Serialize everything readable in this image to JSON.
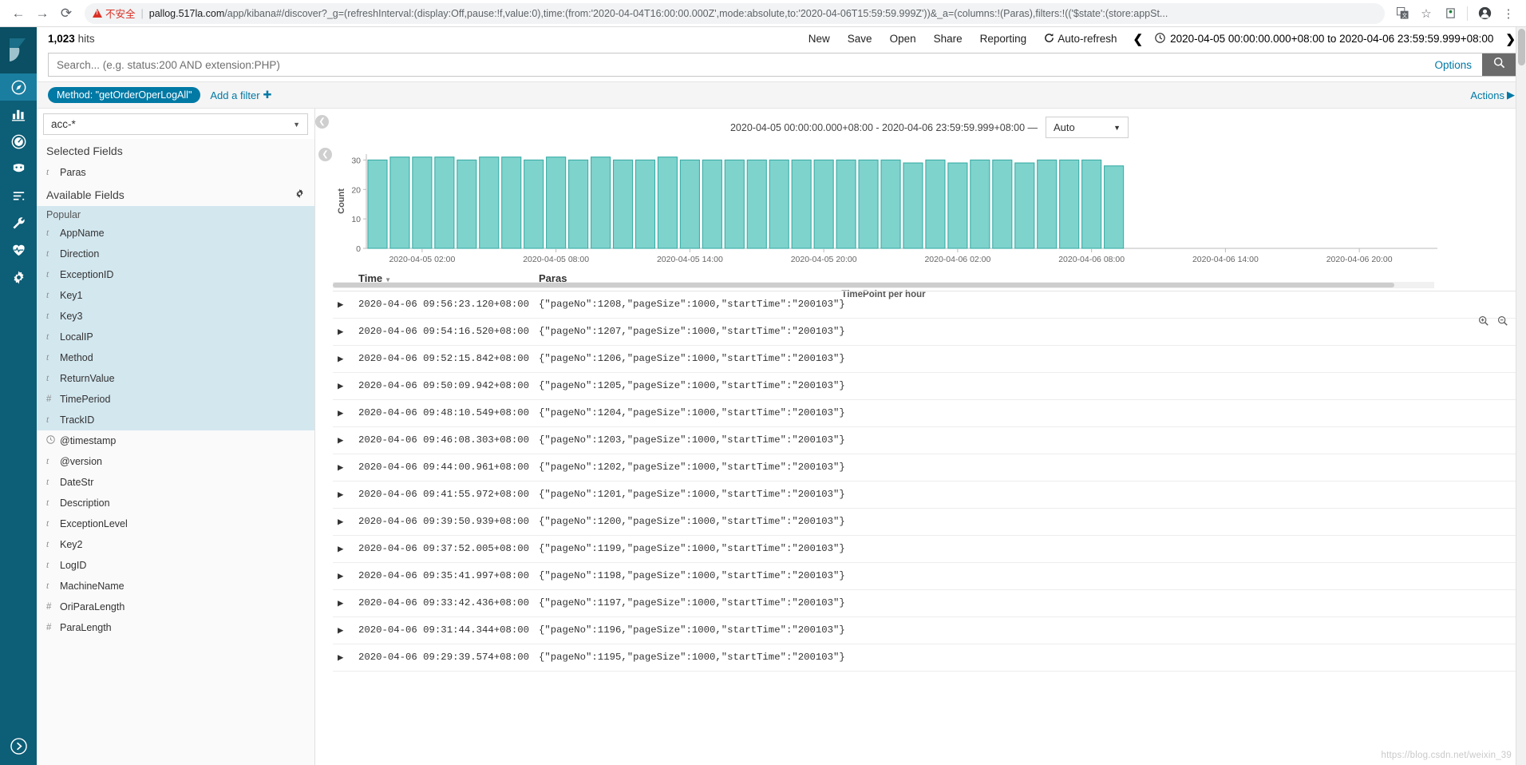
{
  "browser": {
    "back_icon": "arrow-left-icon",
    "forward_icon": "arrow-right-icon",
    "reload_icon": "reload-icon",
    "security_warning": "不安全",
    "url_host": "pallog.517la.com",
    "url_path": "/app/kibana#/discover?_g=(refreshInterval:(display:Off,pause:!f,value:0),time:(from:'2020-04-04T16:00:00.000Z',mode:absolute,to:'2020-04-06T15:59:59.999Z'))&_a=(columns:!(Paras),filters:!(('$state':(store:appSt...",
    "icons": [
      "translate-icon",
      "star-icon",
      "extension-icon",
      "profile-icon",
      "menu-icon"
    ]
  },
  "nav": {
    "logo": "kibana-logo",
    "items": [
      {
        "name": "discover",
        "icon": "compass-icon",
        "active": true
      },
      {
        "name": "visualize",
        "icon": "bar-chart-icon",
        "active": false
      },
      {
        "name": "dashboard",
        "icon": "dashboard-icon",
        "active": false
      },
      {
        "name": "timelion",
        "icon": "timelion-icon",
        "active": false
      },
      {
        "name": "apm",
        "icon": "lines-icon",
        "active": false
      },
      {
        "name": "devtools",
        "icon": "wrench-icon",
        "active": false
      },
      {
        "name": "monitoring",
        "icon": "heartbeat-icon",
        "active": false
      },
      {
        "name": "management",
        "icon": "gear-icon",
        "active": false
      }
    ],
    "bottom": {
      "name": "collapse",
      "icon": "chevron-circle-right-icon"
    }
  },
  "topbar": {
    "hits_count": "1,023",
    "hits_label": "hits",
    "menu": [
      "New",
      "Save",
      "Open",
      "Share",
      "Reporting"
    ],
    "auto_refresh_label": "Auto-refresh",
    "refresh_icon": "refresh-icon",
    "prev_icon": "chevron-left-icon",
    "next_icon": "chevron-right-icon",
    "clock_icon": "clock-icon",
    "time_range": "2020-04-05 00:00:00.000+08:00 to 2020-04-06 23:59:59.999+08:00"
  },
  "search": {
    "value": "",
    "placeholder": "Search... (e.g. status:200 AND extension:PHP)",
    "options_label": "Options",
    "submit_icon": "search-icon"
  },
  "filters": {
    "pill_label": "Method: \"getOrderOperLogAll\"",
    "add_filter_label": "Add a filter",
    "add_icon": "plus-icon",
    "actions_label": "Actions",
    "actions_icon": "caret-right-icon"
  },
  "sidebar": {
    "index_pattern": "acc-*",
    "index_caret": "caret-down-icon",
    "selected_fields_label": "Selected Fields",
    "selected_fields": [
      {
        "type": "t",
        "name": "Paras"
      }
    ],
    "available_fields_label": "Available Fields",
    "settings_icon": "gear-icon",
    "popular_label": "Popular",
    "popular_fields": [
      {
        "type": "t",
        "name": "AppName"
      },
      {
        "type": "t",
        "name": "Direction"
      },
      {
        "type": "t",
        "name": "ExceptionID"
      },
      {
        "type": "t",
        "name": "Key1"
      },
      {
        "type": "t",
        "name": "Key3"
      },
      {
        "type": "t",
        "name": "LocalIP"
      },
      {
        "type": "t",
        "name": "Method"
      },
      {
        "type": "t",
        "name": "ReturnValue"
      },
      {
        "type": "#",
        "name": "TimePeriod"
      },
      {
        "type": "t",
        "name": "TrackID"
      }
    ],
    "other_fields": [
      {
        "type": "clock",
        "name": "@timestamp"
      },
      {
        "type": "t",
        "name": "@version"
      },
      {
        "type": "t",
        "name": "DateStr"
      },
      {
        "type": "t",
        "name": "Description"
      },
      {
        "type": "t",
        "name": "ExceptionLevel"
      },
      {
        "type": "t",
        "name": "Key2"
      },
      {
        "type": "t",
        "name": "LogID"
      },
      {
        "type": "t",
        "name": "MachineName"
      },
      {
        "type": "#",
        "name": "OriParaLength"
      },
      {
        "type": "#",
        "name": "ParaLength"
      }
    ],
    "collapse_icon": "chevron-circle-left-icon"
  },
  "chart_header": {
    "range_text": "2020-04-05 00:00:00.000+08:00 - 2020-04-06 23:59:59.999+08:00 —",
    "interval_value": "Auto",
    "interval_caret": "caret-down-icon"
  },
  "chart_data": {
    "type": "bar",
    "title": "",
    "xlabel": "TimePoint per hour",
    "ylabel": "Count",
    "ylim": [
      0,
      32
    ],
    "yticks": [
      0,
      10,
      20,
      30
    ],
    "grid": false,
    "legend": null,
    "bar_color": "#7fd3cd",
    "bar_stroke": "#3aada6",
    "xticks": [
      "2020-04-05 02:00",
      "2020-04-05 08:00",
      "2020-04-05 14:00",
      "2020-04-05 20:00",
      "2020-04-06 02:00",
      "2020-04-06 08:00",
      "2020-04-06 14:00",
      "2020-04-06 20:00"
    ],
    "categories": [
      "2020-04-05 00:00",
      "2020-04-05 01:00",
      "2020-04-05 02:00",
      "2020-04-05 03:00",
      "2020-04-05 04:00",
      "2020-04-05 05:00",
      "2020-04-05 06:00",
      "2020-04-05 07:00",
      "2020-04-05 08:00",
      "2020-04-05 09:00",
      "2020-04-05 10:00",
      "2020-04-05 11:00",
      "2020-04-05 12:00",
      "2020-04-05 13:00",
      "2020-04-05 14:00",
      "2020-04-05 15:00",
      "2020-04-05 16:00",
      "2020-04-05 17:00",
      "2020-04-05 18:00",
      "2020-04-05 19:00",
      "2020-04-05 20:00",
      "2020-04-05 21:00",
      "2020-04-05 22:00",
      "2020-04-05 23:00",
      "2020-04-06 00:00",
      "2020-04-06 01:00",
      "2020-04-06 02:00",
      "2020-04-06 03:00",
      "2020-04-06 04:00",
      "2020-04-06 05:00",
      "2020-04-06 06:00",
      "2020-04-06 07:00",
      "2020-04-06 08:00",
      "2020-04-06 09:00"
    ],
    "values": [
      30,
      31,
      31,
      31,
      30,
      31,
      31,
      30,
      31,
      30,
      31,
      30,
      30,
      31,
      30,
      30,
      30,
      30,
      30,
      30,
      30,
      30,
      30,
      30,
      29,
      30,
      29,
      30,
      30,
      29,
      30,
      30,
      30,
      28
    ]
  },
  "table": {
    "columns": [
      "Time",
      "Paras"
    ],
    "sort_icon": "sort-desc-icon",
    "expand_icon": "caret-right-icon",
    "row_tools": [
      "zoom-in-icon",
      "zoom-out-icon"
    ],
    "rows": [
      {
        "time": "2020-04-06 09:56:23.120+08:00",
        "paras": "{\"pageNo\":1208,\"pageSize\":1000,\"startTime\":\"200103\"}"
      },
      {
        "time": "2020-04-06 09:54:16.520+08:00",
        "paras": "{\"pageNo\":1207,\"pageSize\":1000,\"startTime\":\"200103\"}"
      },
      {
        "time": "2020-04-06 09:52:15.842+08:00",
        "paras": "{\"pageNo\":1206,\"pageSize\":1000,\"startTime\":\"200103\"}"
      },
      {
        "time": "2020-04-06 09:50:09.942+08:00",
        "paras": "{\"pageNo\":1205,\"pageSize\":1000,\"startTime\":\"200103\"}"
      },
      {
        "time": "2020-04-06 09:48:10.549+08:00",
        "paras": "{\"pageNo\":1204,\"pageSize\":1000,\"startTime\":\"200103\"}"
      },
      {
        "time": "2020-04-06 09:46:08.303+08:00",
        "paras": "{\"pageNo\":1203,\"pageSize\":1000,\"startTime\":\"200103\"}"
      },
      {
        "time": "2020-04-06 09:44:00.961+08:00",
        "paras": "{\"pageNo\":1202,\"pageSize\":1000,\"startTime\":\"200103\"}"
      },
      {
        "time": "2020-04-06 09:41:55.972+08:00",
        "paras": "{\"pageNo\":1201,\"pageSize\":1000,\"startTime\":\"200103\"}"
      },
      {
        "time": "2020-04-06 09:39:50.939+08:00",
        "paras": "{\"pageNo\":1200,\"pageSize\":1000,\"startTime\":\"200103\"}"
      },
      {
        "time": "2020-04-06 09:37:52.005+08:00",
        "paras": "{\"pageNo\":1199,\"pageSize\":1000,\"startTime\":\"200103\"}"
      },
      {
        "time": "2020-04-06 09:35:41.997+08:00",
        "paras": "{\"pageNo\":1198,\"pageSize\":1000,\"startTime\":\"200103\"}"
      },
      {
        "time": "2020-04-06 09:33:42.436+08:00",
        "paras": "{\"pageNo\":1197,\"pageSize\":1000,\"startTime\":\"200103\"}"
      },
      {
        "time": "2020-04-06 09:31:44.344+08:00",
        "paras": "{\"pageNo\":1196,\"pageSize\":1000,\"startTime\":\"200103\"}"
      },
      {
        "time": "2020-04-06 09:29:39.574+08:00",
        "paras": "{\"pageNo\":1195,\"pageSize\":1000,\"startTime\":\"200103\"}"
      }
    ]
  },
  "watermark": "https://blog.csdn.net/weixin_39"
}
